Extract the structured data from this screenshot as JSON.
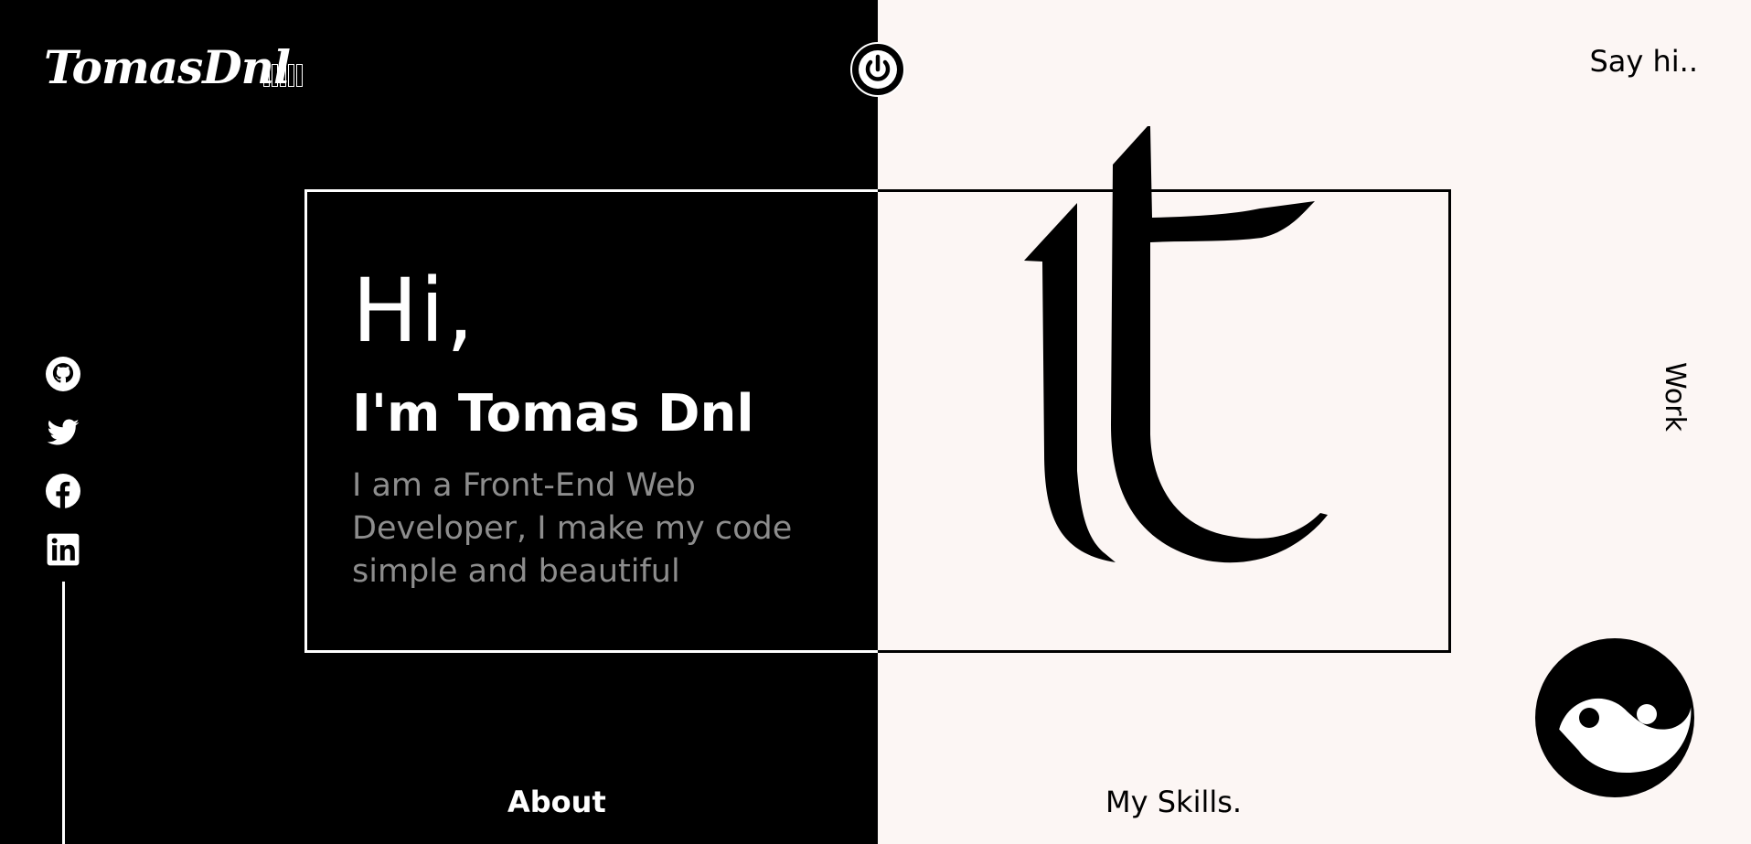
{
  "brand": {
    "logo_text": "TomasDnl",
    "logo_suffix_boxes": 5
  },
  "header": {
    "theme_toggle_icon": "power-icon",
    "contact_link": "Say hi.."
  },
  "social_links": [
    {
      "name": "github",
      "icon": "github-icon"
    },
    {
      "name": "twitter",
      "icon": "twitter-icon"
    },
    {
      "name": "facebook",
      "icon": "facebook-icon"
    },
    {
      "name": "linkedin",
      "icon": "linkedin-icon"
    }
  ],
  "hero": {
    "greeting": "Hi,",
    "name": "I'm Tomas Dnl",
    "description": "I am a Front-End Web Developer, I make my code simple and beautiful"
  },
  "nav": {
    "work": "Work",
    "about": "About",
    "skills": "My Skills."
  },
  "colors": {
    "dark": "#000000",
    "light": "#fcf6f4",
    "muted_text": "#8d8d8d"
  }
}
